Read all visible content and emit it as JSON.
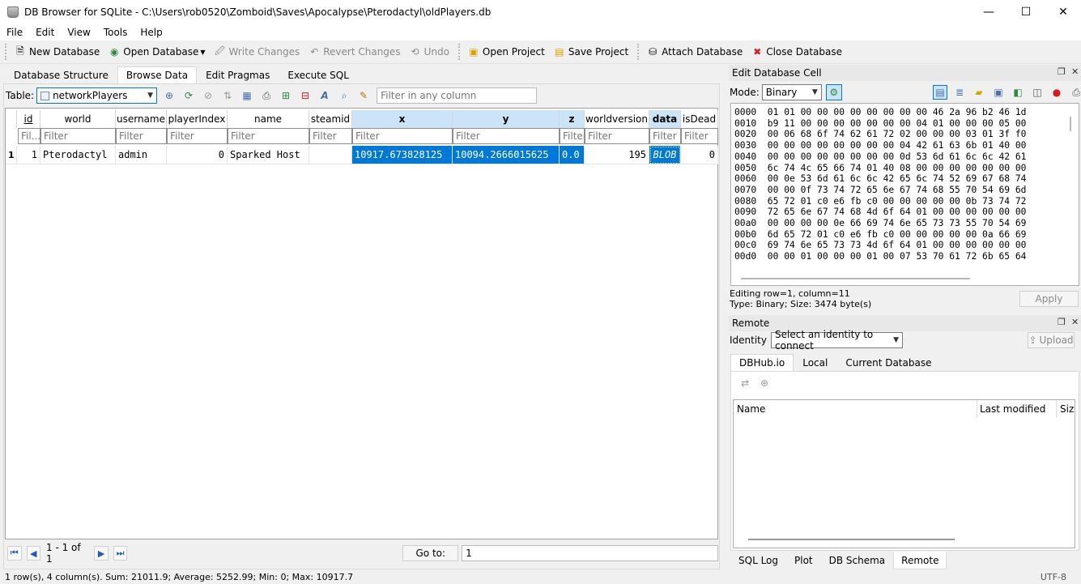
{
  "window": {
    "title": "DB Browser for SQLite - C:\\Users\\rob0520\\Zomboid\\Saves\\Apocalypse\\Pterodactyl\\oldPlayers.db",
    "minimize": "—",
    "maximize": "☐",
    "close": "✕"
  },
  "menu": [
    "File",
    "Edit",
    "View",
    "Tools",
    "Help"
  ],
  "toolbar": {
    "new_database": "New Database",
    "open_database": "Open Database",
    "write_changes": "Write Changes",
    "revert_changes": "Revert Changes",
    "undo": "Undo",
    "open_project": "Open Project",
    "save_project": "Save Project",
    "attach_database": "Attach Database",
    "close_database": "Close Database"
  },
  "tabs": [
    "Database Structure",
    "Browse Data",
    "Edit Pragmas",
    "Execute SQL"
  ],
  "browse": {
    "table_label": "Table:",
    "table_value": "networkPlayers",
    "filter_any_placeholder": "Filter in any column",
    "columns": [
      "id",
      "world",
      "username",
      "playerIndex",
      "name",
      "steamid",
      "x",
      "y",
      "z",
      "worldversion",
      "data",
      "isDead"
    ],
    "filter_placeholders": [
      "Fil...",
      "Filter",
      "Filter",
      "Filter",
      "Filter",
      "Filter",
      "Filter",
      "Filter",
      "Filter",
      "Filter",
      "Filter",
      "Filter"
    ],
    "row_number": "1",
    "rows": [
      [
        "1",
        "Pterodactyl",
        "admin",
        "0",
        "Sparked Host",
        "",
        "10917.673828125",
        "10094.2666015625",
        "0.0",
        "195",
        "BLOB",
        "0"
      ]
    ]
  },
  "nav": {
    "range": "1 - 1 of 1",
    "goto_label": "Go to:",
    "goto_value": "1"
  },
  "status": {
    "text": "1 row(s), 4 column(s). Sum: 21011.9; Average: 5252.99; Min: 0; Max: 10917.7",
    "encoding": "UTF-8"
  },
  "edit_cell": {
    "title": "Edit Database Cell",
    "mode_label": "Mode:",
    "mode_value": "Binary",
    "hex_lines": [
      "0000  01 01 00 00 00 00 00 00 00 00 46 2a 96 b2 46 1d",
      "0010  b9 11 00 00 00 00 00 00 00 04 01 00 00 00 05 00",
      "0020  00 06 68 6f 74 62 61 72 02 00 00 00 03 01 3f f0",
      "0030  00 00 00 00 00 00 00 00 04 42 61 63 6b 01 40 00",
      "0040  00 00 00 00 00 00 00 00 0d 53 6d 61 6c 6c 42 61",
      "0050  6c 74 4c 65 66 74 01 40 08 00 00 00 00 00 00 00",
      "0060  00 0e 53 6d 61 6c 6c 42 65 6c 74 52 69 67 68 74",
      "0070  00 00 0f 73 74 72 65 6e 67 74 68 55 70 54 69 6d",
      "0080  65 72 01 c0 e6 fb c0 00 00 00 00 00 0b 73 74 72",
      "0090  72 65 6e 67 74 68 4d 6f 64 01 00 00 00 00 00 00",
      "00a0  00 00 00 00 0e 66 69 74 6e 65 73 73 55 70 54 69",
      "00b0  6d 65 72 01 c0 e6 fb c0 00 00 00 00 00 0a 66 69",
      "00c0  69 74 6e 65 73 73 4d 6f 64 01 00 00 00 00 00 00",
      "00d0  00 00 01 00 00 00 01 00 07 53 70 61 72 6b 65 64"
    ],
    "editing_info": "Editing row=1, column=11",
    "type_info": "Type: Binary; Size: 3474 byte(s)",
    "apply": "Apply"
  },
  "remote": {
    "title": "Remote",
    "identity_label": "Identity",
    "identity_value": "Select an identity to connect",
    "upload": "Upload",
    "tabs": [
      "DBHub.io",
      "Local",
      "Current Database"
    ],
    "columns": [
      "Name",
      "Last modified",
      "Size"
    ]
  },
  "bottom_tabs": [
    "SQL Log",
    "Plot",
    "DB Schema",
    "Remote"
  ]
}
